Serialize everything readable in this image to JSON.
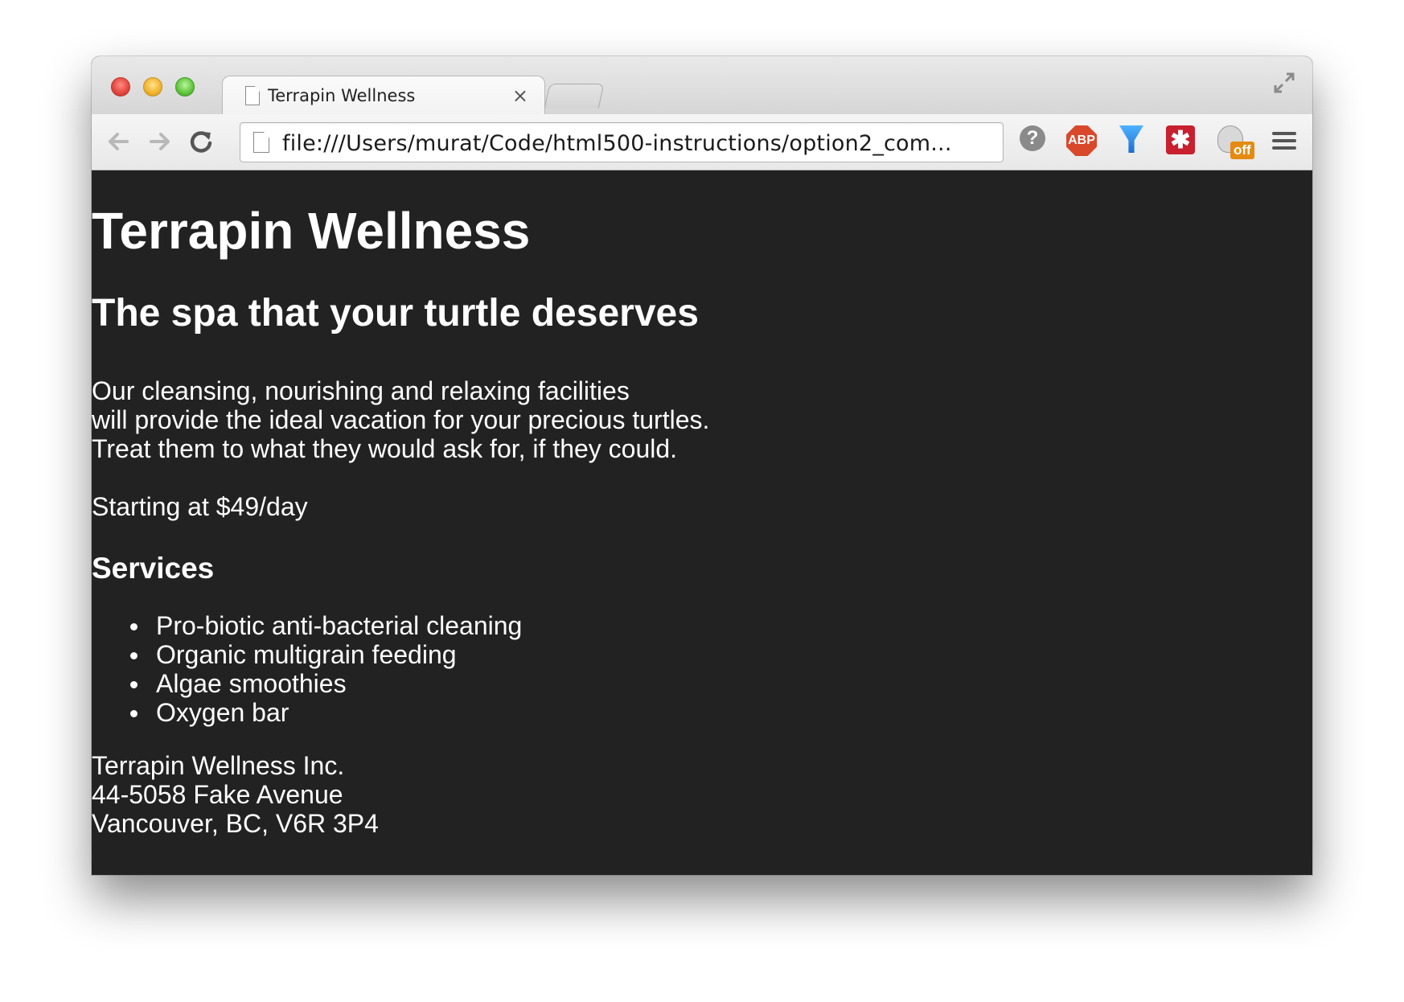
{
  "browser": {
    "tab_title": "Terrapin Wellness",
    "tab_close_glyph": "×",
    "url": "file:///Users/murat/Code/html500-instructions/option2_com...",
    "icons": [
      "back-icon",
      "forward-icon",
      "reload-icon",
      "page-icon",
      "help-icon",
      "adblock-icon",
      "funnel-icon",
      "lastpass-icon",
      "mascot-off-icon",
      "menu-icon",
      "fullscreen-icon"
    ],
    "abp_label": "ABP",
    "mascot_badge": "off"
  },
  "page": {
    "title": "Terrapin Wellness",
    "tagline": "The spa that your turtle deserves",
    "intro_lines": [
      "Our cleansing, nourishing and relaxing facilities",
      "will provide the ideal vacation for your precious turtles.",
      "Treat them to what they would ask for, if they could."
    ],
    "price": "Starting at $49/day",
    "services_heading": "Services",
    "services": [
      "Pro-biotic anti-bacterial cleaning",
      "Organic multigrain feeding",
      "Algae smoothies",
      "Oxygen bar"
    ],
    "address_lines": [
      "Terrapin Wellness Inc.",
      "44-5058 Fake Avenue",
      "Vancouver, BC, V6R 3P4"
    ],
    "background_color": "#222222",
    "text_color": "#ffffff"
  }
}
